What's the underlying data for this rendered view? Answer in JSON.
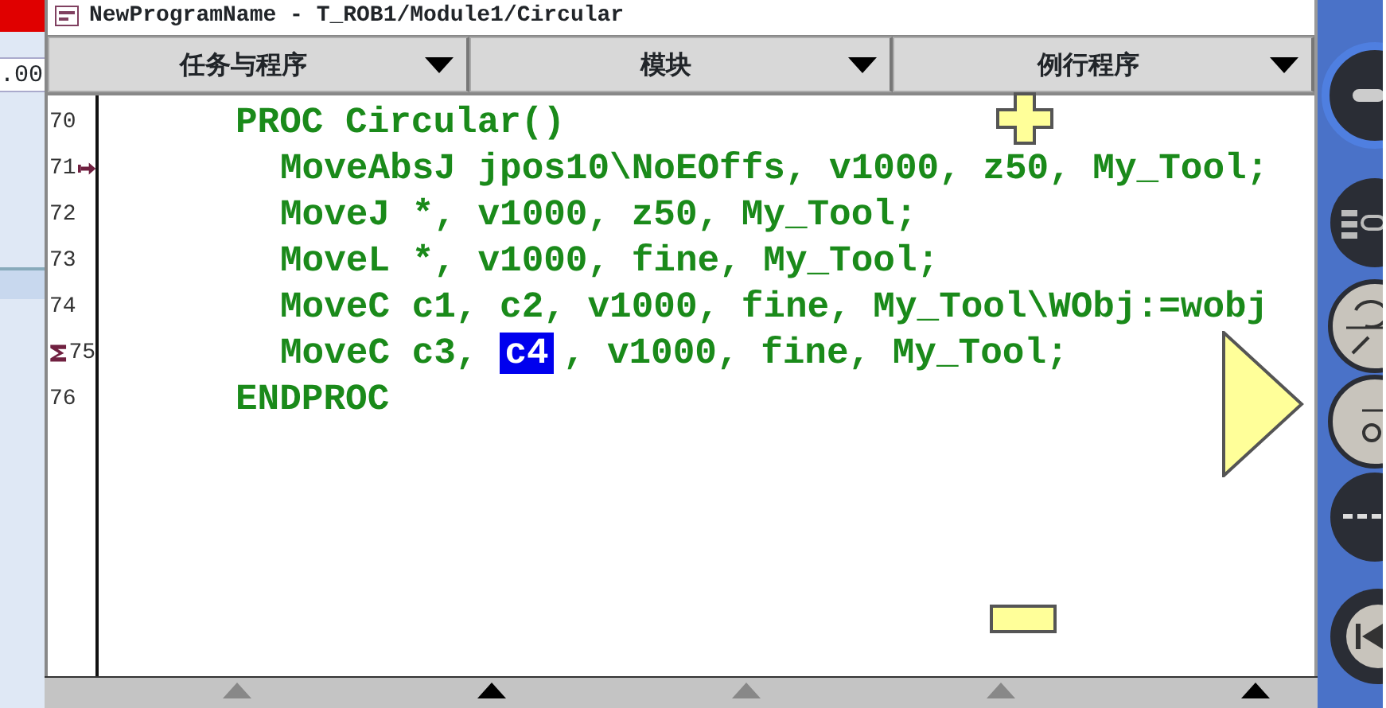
{
  "left_panel": {
    "field_value": ".00"
  },
  "window": {
    "title": "NewProgramName - T_ROB1/Module1/Circular"
  },
  "tabs": [
    {
      "label": "任务与程序"
    },
    {
      "label": "模块"
    },
    {
      "label": "例行程序"
    }
  ],
  "code": [
    {
      "number": "70",
      "text": "PROC Circular()",
      "program_pointer": false,
      "motion_pointer": false,
      "children": [
        {
          "number": "71",
          "text": "MoveAbsJ jpos10\\NoEOffs, v1000, z50, My_Tool;",
          "program_pointer": true,
          "motion_pointer": false
        },
        {
          "number": "72",
          "text": "MoveJ *, v1000, z50, My_Tool;",
          "program_pointer": false,
          "motion_pointer": false
        },
        {
          "number": "73",
          "text": "MoveL *, v1000, fine, My_Tool;",
          "program_pointer": false,
          "motion_pointer": false
        },
        {
          "number": "74",
          "text": "MoveC c1, c2, v1000, fine, My_Tool\\WObj:=wobj",
          "program_pointer": false,
          "motion_pointer": false
        },
        {
          "number": "75",
          "program_pointer": false,
          "motion_pointer": true,
          "parts": [
            {
              "text": "MoveC c3,",
              "selected": false
            },
            {
              "text": "c4",
              "selected": true
            },
            {
              "text": ", v1000, fine, My_Tool;",
              "selected": false
            }
          ]
        }
      ]
    },
    {
      "number": "76",
      "text": "ENDPROC",
      "program_pointer": false,
      "motion_pointer": false
    }
  ],
  "bottom_menu": [
    {
      "disabled": true
    },
    {
      "disabled": false
    },
    {
      "disabled": true
    },
    {
      "disabled": true
    },
    {
      "disabled": false
    }
  ]
}
